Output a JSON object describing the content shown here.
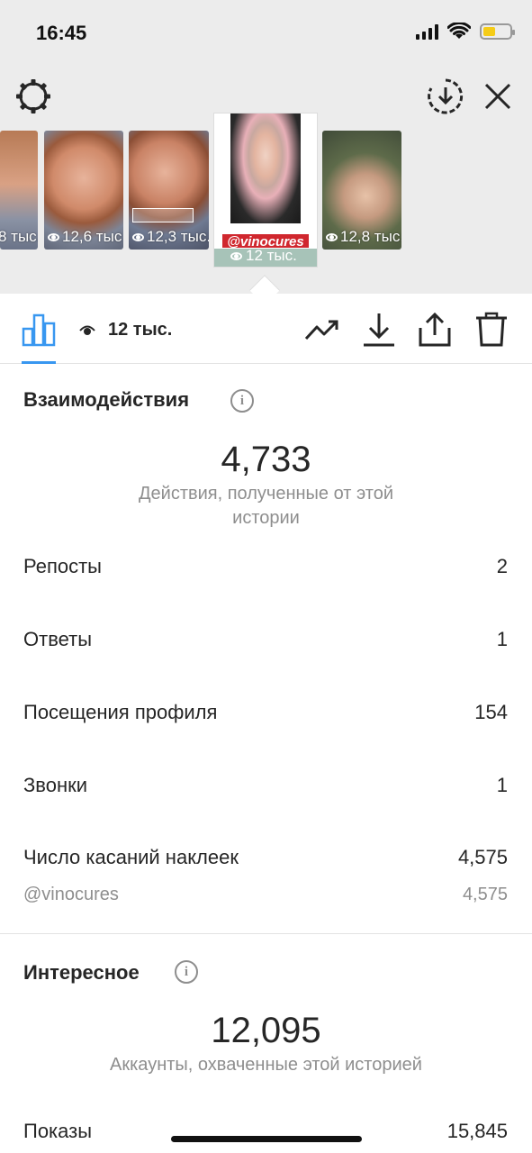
{
  "status": {
    "time": "16:45"
  },
  "stories": [
    {
      "views": "8 тыс."
    },
    {
      "views": "12,6 тыс"
    },
    {
      "views": "12,3 тыс."
    },
    {
      "views": "12 тыс.",
      "sticker": "@vinocures",
      "selected": true
    },
    {
      "views": "12,8 тыс."
    }
  ],
  "toolbar": {
    "views": "12 тыс."
  },
  "interactions": {
    "title": "Взаимодействия",
    "total": "4,733",
    "description": "Действия, полученные от этой истории",
    "rows": [
      {
        "label": "Репосты",
        "value": "2"
      },
      {
        "label": "Ответы",
        "value": "1"
      },
      {
        "label": "Посещения профиля",
        "value": "154"
      },
      {
        "label": "Звонки",
        "value": "1"
      },
      {
        "label": "Число касаний наклеек",
        "value": "4,575"
      }
    ],
    "sub_row": {
      "label": "@vinocures",
      "value": "4,575"
    }
  },
  "discovery": {
    "title": "Интересное",
    "total": "12,095",
    "description": "Аккаунты, охваченные этой историей",
    "rows": [
      {
        "label": "Показы",
        "value": "15,845"
      }
    ]
  },
  "colors": {
    "accent": "#3897f0",
    "sticker": "#d0272e",
    "battery": "#f5cc18"
  }
}
